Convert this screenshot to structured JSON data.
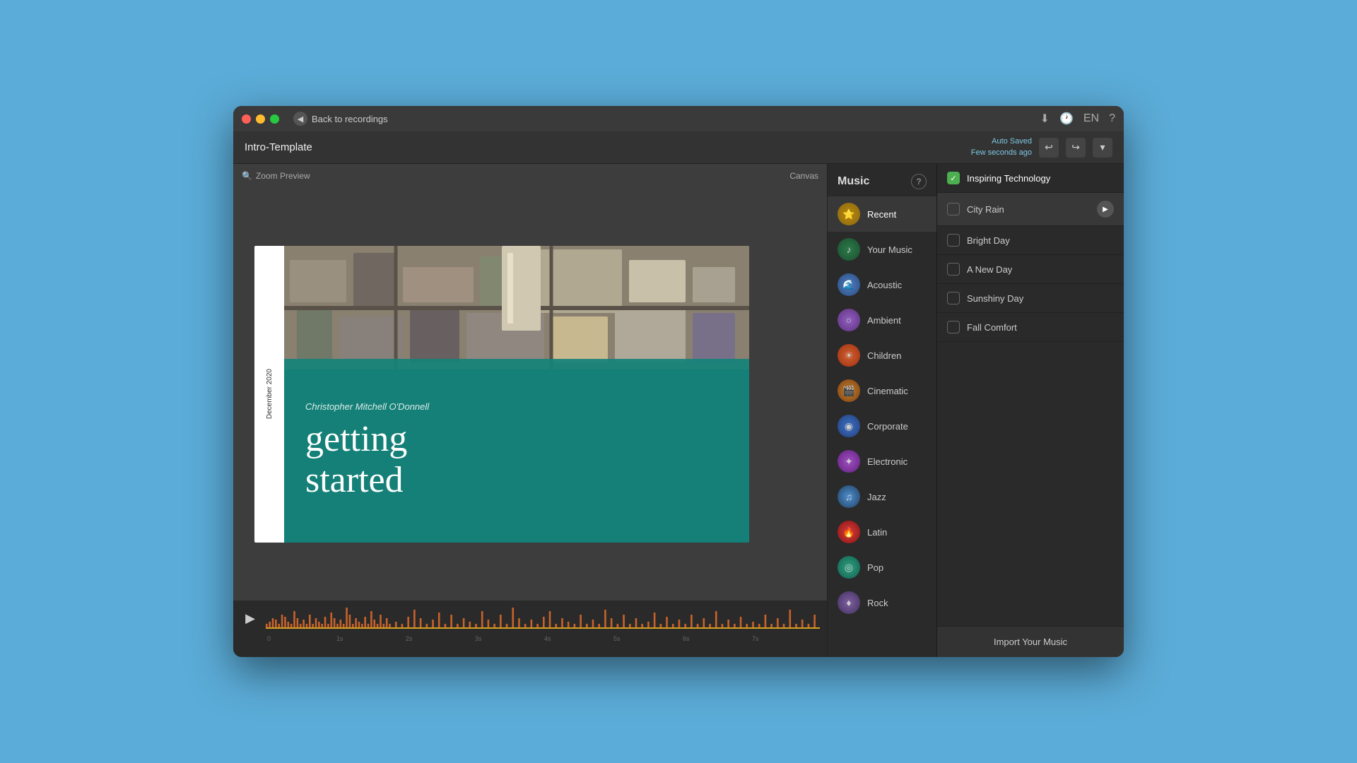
{
  "window": {
    "title": "Intro-Template",
    "back_label": "Back to recordings",
    "auto_saved": "Auto Saved",
    "auto_saved_time": "Few seconds ago",
    "language": "EN"
  },
  "toolbar": {
    "zoom_preview": "Zoom Preview",
    "canvas_label": "Canvas"
  },
  "slide": {
    "date": "December 2020",
    "author": "Christopher Mitchell O'Donnell",
    "line1": "getting",
    "line2": "started"
  },
  "timeline": {
    "marks": [
      "0",
      "1s",
      "2s",
      "3s",
      "4s",
      "5s",
      "6s",
      "7s"
    ]
  },
  "music_panel": {
    "title": "Music",
    "help": "?",
    "import_label": "Import Your Music",
    "categories": [
      {
        "id": "recent",
        "label": "Recent",
        "icon": "⭐",
        "class": "cat-recent",
        "active": true
      },
      {
        "id": "yourmusic",
        "label": "Your Music",
        "icon": "🎵",
        "class": "cat-yourmusic"
      },
      {
        "id": "acoustic",
        "label": "Acoustic",
        "icon": "🌊",
        "class": "cat-acoustic"
      },
      {
        "id": "ambient",
        "label": "Ambient",
        "icon": "🌀",
        "class": "cat-ambient"
      },
      {
        "id": "children",
        "label": "Children",
        "icon": "🌅",
        "class": "cat-children"
      },
      {
        "id": "cinematic",
        "label": "Cinematic",
        "icon": "🎬",
        "class": "cat-cinematic"
      },
      {
        "id": "corporate",
        "label": "Corporate",
        "icon": "🌐",
        "class": "cat-corporate"
      },
      {
        "id": "electronic",
        "label": "Electronic",
        "icon": "💜",
        "class": "cat-electronic"
      },
      {
        "id": "jazz",
        "label": "Jazz",
        "icon": "🎷",
        "class": "cat-jazz"
      },
      {
        "id": "latin",
        "label": "Latin",
        "icon": "🔥",
        "class": "cat-latin"
      },
      {
        "id": "pop",
        "label": "Pop",
        "icon": "🎙",
        "class": "cat-pop"
      },
      {
        "id": "rock",
        "label": "Rock",
        "icon": "🎸",
        "class": "cat-rock"
      }
    ],
    "tracks": [
      {
        "id": "inspiring",
        "label": "Inspiring Technology",
        "checked": true,
        "playing": false
      },
      {
        "id": "cityrain",
        "label": "City Rain",
        "checked": false,
        "playing": true
      },
      {
        "id": "brightday",
        "label": "Bright Day",
        "checked": false,
        "playing": false
      },
      {
        "id": "anewday",
        "label": "A New Day",
        "checked": false,
        "playing": false
      },
      {
        "id": "sunshiny",
        "label": "Sunshiny Day",
        "checked": false,
        "playing": false
      },
      {
        "id": "fallcomfort",
        "label": "Fall Comfort",
        "checked": false,
        "playing": false
      }
    ]
  }
}
